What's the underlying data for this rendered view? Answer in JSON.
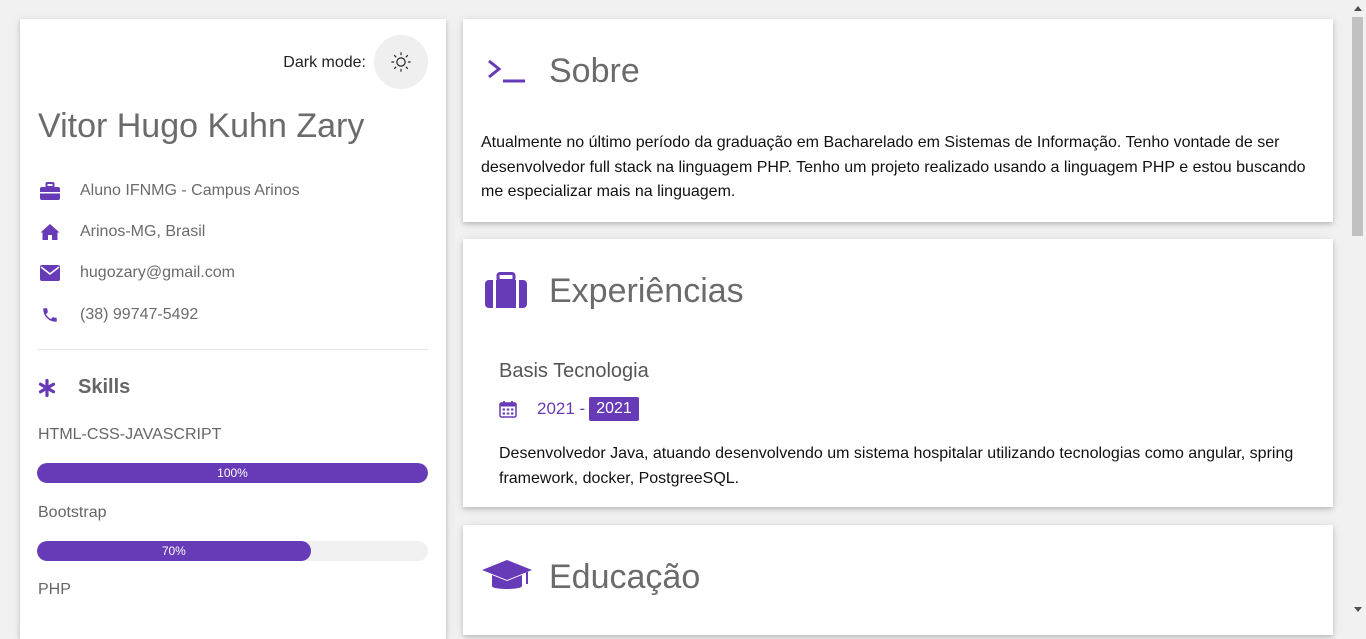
{
  "theme": {
    "accent": "#673ab7",
    "background": "#f1f1f1"
  },
  "profile": {
    "dark_mode_label": "Dark mode:",
    "dark_mode_icon": "sun-icon",
    "name": "Vitor Hugo Kuhn Zary",
    "info": [
      {
        "icon": "briefcase-icon",
        "text": "Aluno IFNMG - Campus Arinos"
      },
      {
        "icon": "home-icon",
        "text": "Arinos-MG, Brasil"
      },
      {
        "icon": "envelope-icon",
        "text": "hugozary@gmail.com"
      },
      {
        "icon": "phone-icon",
        "text": "(38) 99747-5492"
      }
    ],
    "skills_title": "Skills",
    "skills": [
      {
        "name": "HTML-CSS-JAVASCRIPT",
        "level": 100,
        "label": "100%"
      },
      {
        "name": "Bootstrap",
        "level": 70,
        "label": "70%"
      },
      {
        "name": "PHP"
      }
    ]
  },
  "sobre": {
    "title": "Sobre",
    "text": "Atualmente no último período da graduação em Bacharelado em Sistemas de Informação. Tenho vontade de ser desenvolvedor full stack na linguagem PHP. Tenho um projeto realizado usando a linguagem PHP e estou buscando me especializar mais na linguagem."
  },
  "experiencias": {
    "title": "Experiências",
    "items": [
      {
        "company": "Basis Tecnologia",
        "from": "2021 -",
        "to": "2021",
        "description": "Desenvolvedor Java, atuando desenvolvendo um sistema hospitalar utilizando tecnologias como angular, spring framework, docker, PostgreeSQL."
      }
    ]
  },
  "educacao": {
    "title": "Educação"
  }
}
